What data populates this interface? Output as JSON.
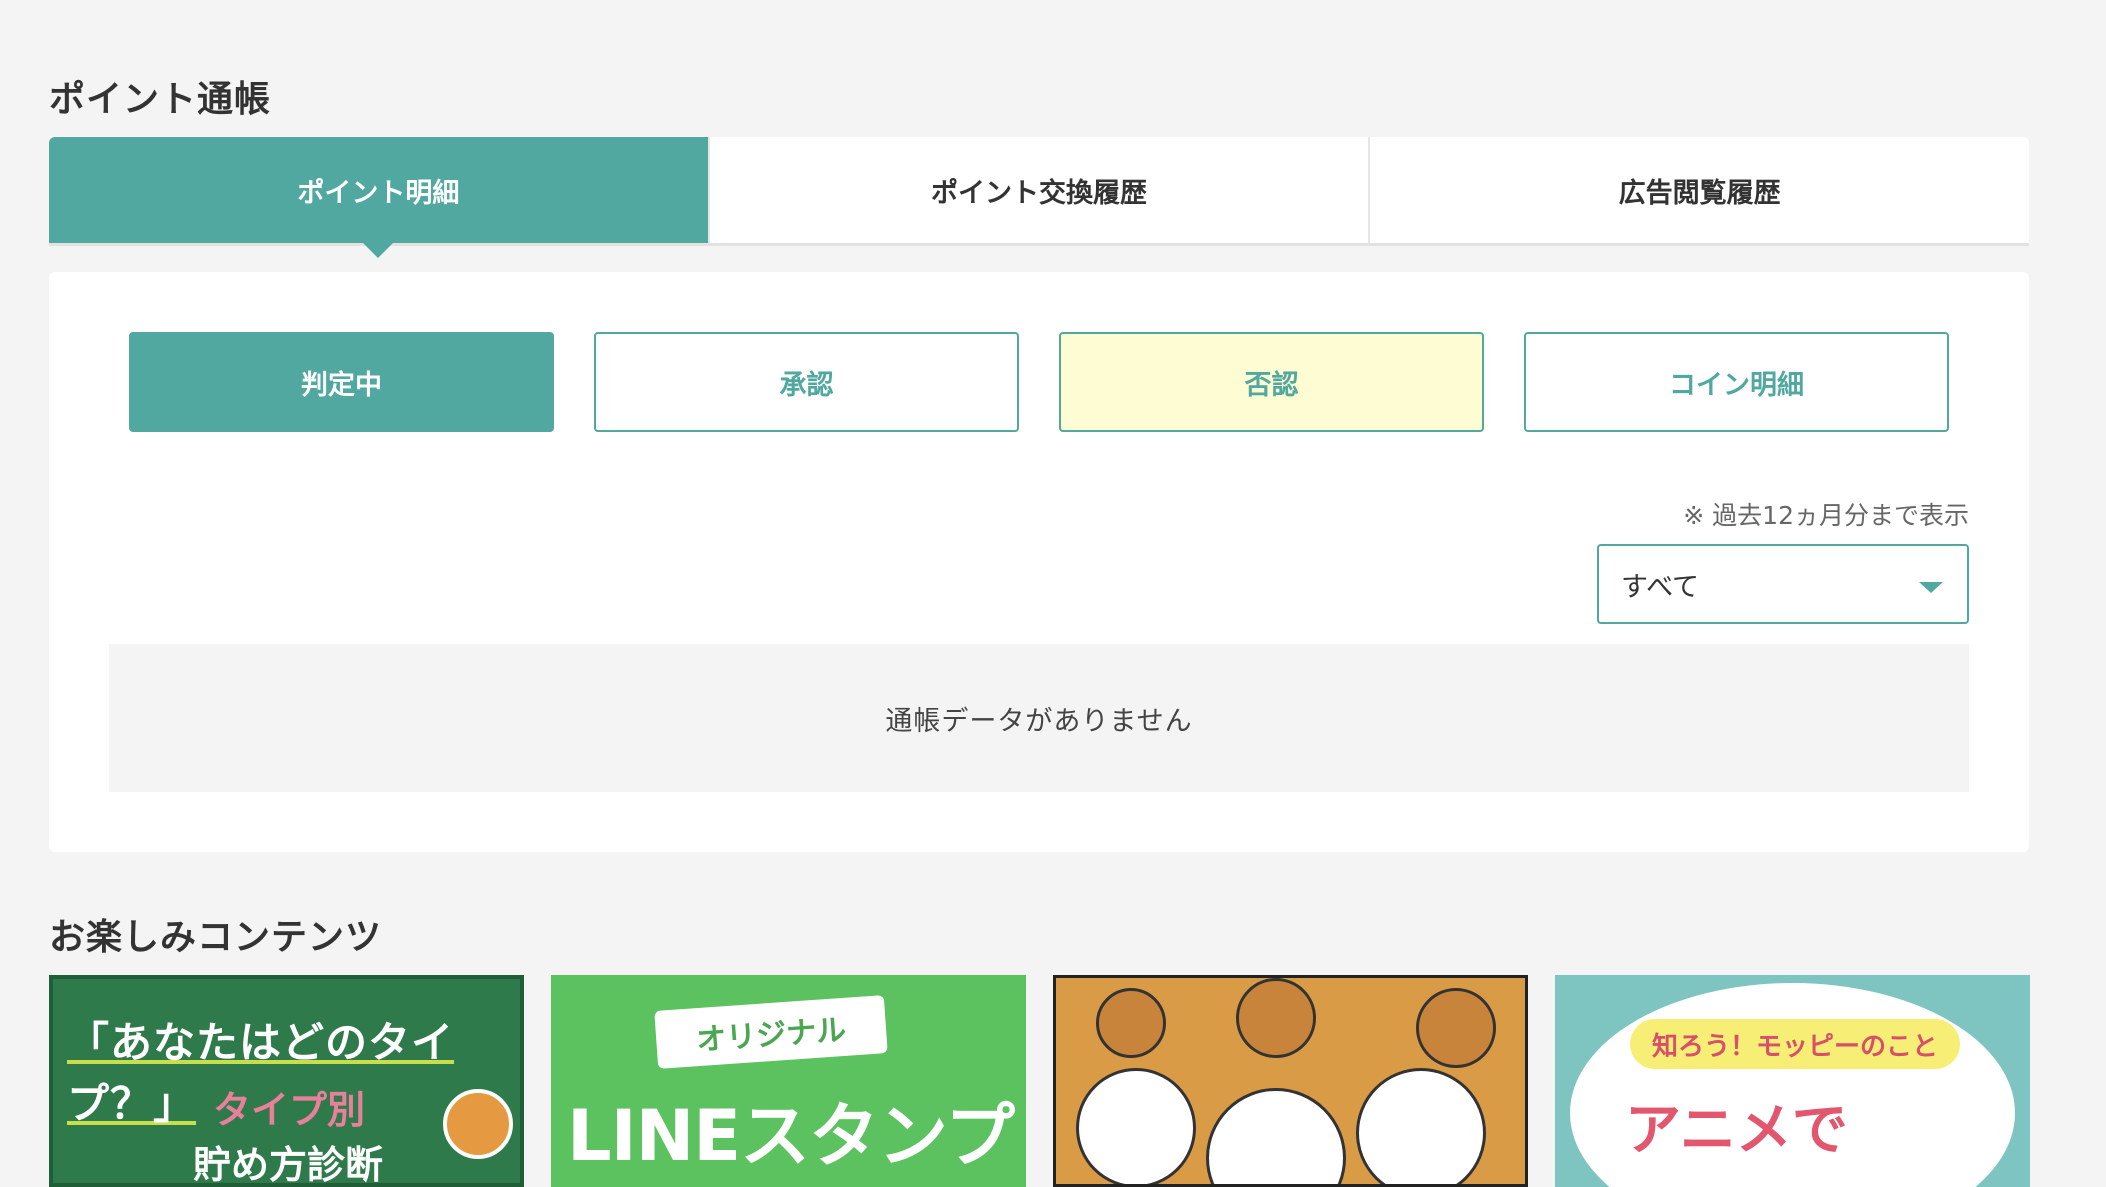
{
  "passbook": {
    "title": "ポイント通帳",
    "tabs": [
      {
        "label": "ポイント明細",
        "active": true
      },
      {
        "label": "ポイント交換履歴",
        "active": false
      },
      {
        "label": "広告閲覧履歴",
        "active": false
      }
    ],
    "filters": [
      {
        "label": "判定中",
        "state": "active"
      },
      {
        "label": "承認",
        "state": "default"
      },
      {
        "label": "否認",
        "state": "highlight"
      },
      {
        "label": "コイン明細",
        "state": "default"
      }
    ],
    "note": "※ 過去12ヵ月分まで表示",
    "period_select": {
      "value": "すべて"
    },
    "empty_message": "通帳データがありません"
  },
  "fun": {
    "title": "お楽しみコンテンツ",
    "banners": [
      {
        "line1": "「あなたはどのタイプ？」",
        "line2": "タイプ別",
        "line3": "貯め方診断"
      },
      {
        "ribbon": "オリジナル",
        "big": "LINEスタンプ"
      },
      {},
      {
        "tag": "知ろう！モッピーのこと",
        "big": "アニメで"
      }
    ]
  },
  "colors": {
    "accent": "#50a8a0",
    "highlight": "#fdfcd3",
    "background": "#f4f4f4"
  }
}
